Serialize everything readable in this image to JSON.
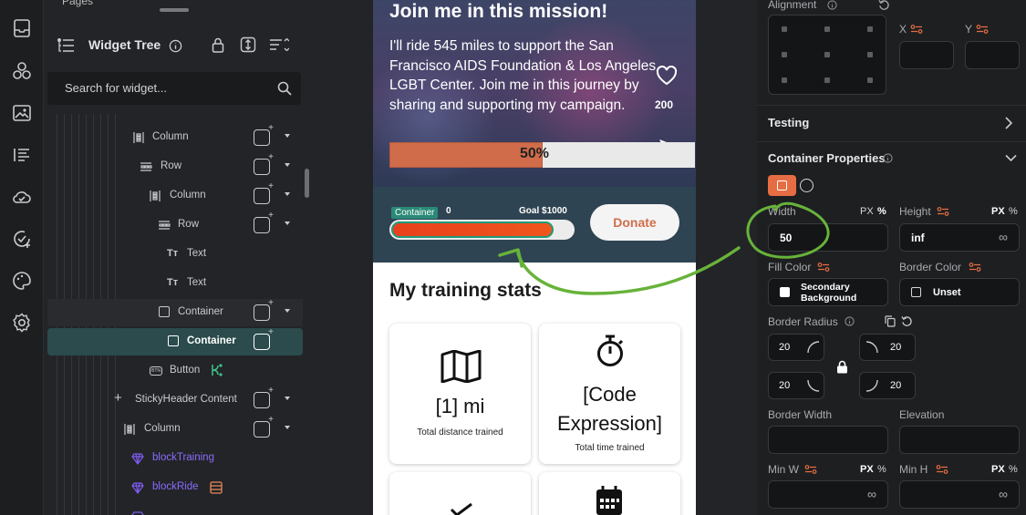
{
  "left_panel": {
    "pages_stub": "Pages",
    "widget_tree_title": "Widget Tree",
    "search_placeholder": "Search for widget...",
    "tree": [
      {
        "label": "Column"
      },
      {
        "label": "Row"
      },
      {
        "label": "Column"
      },
      {
        "label": "Row"
      },
      {
        "label": "Text"
      },
      {
        "label": "Text"
      },
      {
        "label": "Container"
      },
      {
        "label": "Container"
      },
      {
        "label": "Button"
      },
      {
        "label": "StickyHeader Content"
      },
      {
        "label": "Column"
      },
      {
        "label": "blockTraining"
      },
      {
        "label": "blockRide"
      }
    ]
  },
  "canvas": {
    "hero_title": "Join me in this mission!",
    "hero_body": "I'll ride 545 miles to support the San Francisco AIDS Foundation & Los Angeles LGBT Center. Join me in this journey by sharing and supporting my campaign.",
    "like_count": "200",
    "progress_label": "50%",
    "progress_fraction": 0.5,
    "raised_label": "0",
    "goal_label": "Goal $1000",
    "container_tag": "Container",
    "donate_label": "Donate",
    "section_title": "My training stats",
    "stats": [
      {
        "big": "[1] mi",
        "small": "Total distance trained"
      },
      {
        "big": "[Code Expression]",
        "small": "Total time trained"
      }
    ]
  },
  "props": {
    "alignment_label": "Alignment",
    "x_label": "X",
    "y_label": "Y",
    "testing_label": "Testing",
    "container_props_label": "Container Properties",
    "width_label": "Width",
    "width_unit_px": "PX",
    "width_unit_pct": "%",
    "width_value": "50",
    "height_label": "Height",
    "height_unit_px": "PX",
    "height_unit_pct": "%",
    "height_value": "inf",
    "infinity_symbol": "∞",
    "fill_color_label": "Fill Color",
    "fill_color_value": "Secondary Background",
    "border_color_label": "Border Color",
    "border_color_value": "Unset",
    "border_radius_label": "Border Radius",
    "radius_tl": "20",
    "radius_tr": "20",
    "radius_bl": "20",
    "radius_br": "20",
    "border_width_label": "Border Width",
    "elevation_label": "Elevation",
    "min_w_label": "Min W",
    "min_h_label": "Min H",
    "min_unit_px": "PX",
    "min_unit_pct": "%"
  },
  "colors": {
    "accent": "#e66d43",
    "annotation_green": "#67b33a",
    "selected_row": "#2b4b4c",
    "progress_fill": "#d06c4a"
  }
}
